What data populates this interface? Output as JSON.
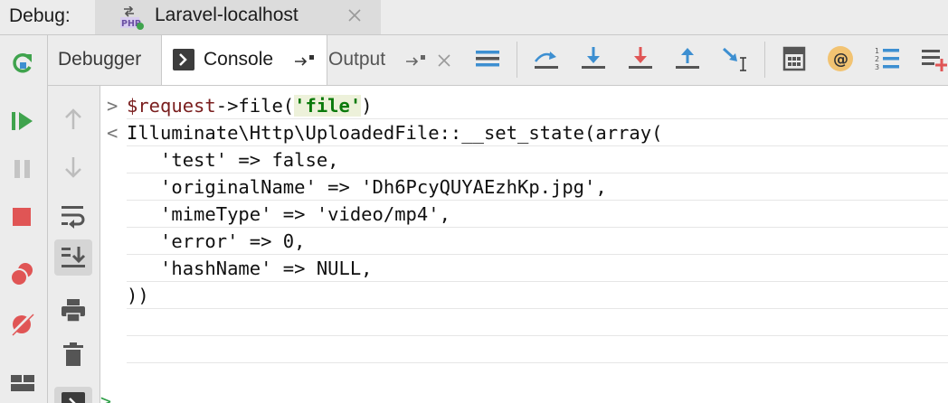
{
  "topbar": {
    "debug_label": "Debug:",
    "run_config": "Laravel-localhost",
    "php_icon_text": "PHP"
  },
  "tabs": [
    {
      "label": "Debugger",
      "selected": false
    },
    {
      "label": "Console",
      "selected": true
    },
    {
      "label": "Output",
      "selected": false
    }
  ],
  "toolbar_icons": [
    "layout-lines-icon",
    "step-over-icon",
    "step-into-icon",
    "force-step-into-icon",
    "step-out-icon",
    "run-to-cursor-icon",
    "evaluate-expression-icon",
    "php-at-icon",
    "numbered-list-icon",
    "add-watch-icon"
  ],
  "left_actions": [
    "rerun-icon",
    "resume-icon",
    "pause-icon",
    "stop-icon",
    "view-breakpoints-icon",
    "mute-breakpoints-icon",
    "layout-icon"
  ],
  "console_actions": [
    "up-arrow-icon",
    "down-arrow-icon",
    "soft-wrap-icon",
    "scroll-to-end-icon",
    "print-icon",
    "trash-icon",
    "console-icon"
  ],
  "console": {
    "input_prompt": ">",
    "output_prompt": "<",
    "input_var": "$request",
    "input_mid": "->file(",
    "input_arg": "'file'",
    "input_end": ")",
    "output_lines": [
      "Illuminate\\Http\\UploadedFile::__set_state(array(",
      "   'test' => false,",
      "   'originalName' => 'Dh6PcyQUYAEzhKp.jpg',",
      "   'mimeType' => 'video/mp4',",
      "   'error' => 0,",
      "   'hashName' => NULL,",
      "))"
    ],
    "next_prompt": ">"
  },
  "colors": {
    "accent_blue": "#3d8fd1",
    "green": "#3fa34d",
    "red": "#e05555",
    "panel_bg": "#ececec"
  }
}
